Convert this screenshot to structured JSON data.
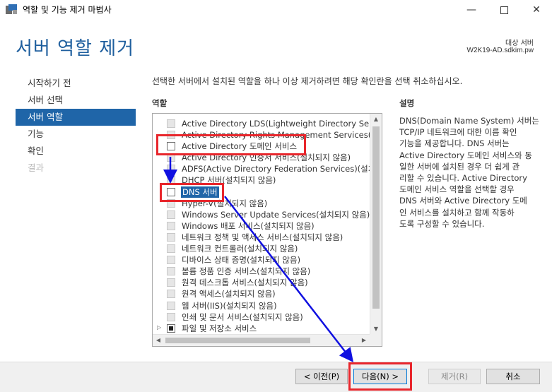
{
  "window": {
    "title": "역할 및 기능 제거 마법사",
    "minimize_glyph": "—",
    "close_glyph": "✕"
  },
  "header": {
    "title": "서버 역할 제거",
    "target_label": "대상 서버",
    "target_server": "W2K19-AD.sdkim.pw"
  },
  "nav": {
    "items": [
      {
        "label": "시작하기 전",
        "state": "normal"
      },
      {
        "label": "서버 선택",
        "state": "normal"
      },
      {
        "label": "서버 역할",
        "state": "active"
      },
      {
        "label": "기능",
        "state": "normal"
      },
      {
        "label": "확인",
        "state": "normal"
      },
      {
        "label": "결과",
        "state": "disabled"
      }
    ]
  },
  "main": {
    "instruction": "선택한 서버에서 설치된 역할을 하나 이상 제거하려면 해당 확인란을 선택 취소하십시오.",
    "roles_label": "역할",
    "description_label": "설명",
    "description_lines": [
      "DNS(Domain Name System) 서버는",
      "TCP/IP 네트워크에 대한 이름 확인",
      "기능을 제공합니다. DNS 서버는",
      "Active Directory 도메인 서비스와 동",
      "일한 서버에 설치된 경우 더 쉽게 관",
      "리할 수 있습니다. Active Directory",
      "도메인 서비스 역할을 선택할 경우",
      "DNS 서버와 Active Directory 도메",
      "인 서비스를 설치하고 함께 작동하",
      "도록 구성할 수 있습니다."
    ],
    "roles": [
      {
        "label": "Active Directory LDS(Lightweight Directory Servic",
        "state": "disabled"
      },
      {
        "label": "Active Directory Rights Management Services(설",
        "state": "disabled"
      },
      {
        "label": "Active Directory 도메인 서비스",
        "state": "enabled"
      },
      {
        "label": "Active Directory 인증서 서비스(설치되지 않음)",
        "state": "disabled"
      },
      {
        "label": "ADFS(Active Directory Federation Services)(설치되",
        "state": "disabled"
      },
      {
        "label": "DHCP 서버(설치되지 않음)",
        "state": "disabled"
      },
      {
        "label": "DNS 서버",
        "state": "enabled",
        "highlighted": true
      },
      {
        "label": "Hyper-V(설치되지 않음)",
        "state": "disabled"
      },
      {
        "label": "Windows Server Update Services(설치되지 않음)",
        "state": "disabled"
      },
      {
        "label": "Windows 배포 서비스(설치되지 않음)",
        "state": "disabled"
      },
      {
        "label": "네트워크 정책 및 액세스 서비스(설치되지 않음)",
        "state": "disabled"
      },
      {
        "label": "네트워크 컨트롤러(설치되지 않음)",
        "state": "disabled"
      },
      {
        "label": "디바이스 상태 증명(설치되지 않음)",
        "state": "disabled"
      },
      {
        "label": "볼륨 정품 인증 서비스(설치되지 않음)",
        "state": "disabled"
      },
      {
        "label": "원격 데스크톱 서비스(설치되지 않음)",
        "state": "disabled"
      },
      {
        "label": "원격 액세스(설치되지 않음)",
        "state": "disabled"
      },
      {
        "label": "웹 서버(IIS)(설치되지 않음)",
        "state": "disabled"
      },
      {
        "label": "인쇄 및 문서 서비스(설치되지 않음)",
        "state": "disabled"
      },
      {
        "label": "파일 및 저장소 서비스",
        "state": "partial",
        "expandable": true
      }
    ]
  },
  "footer": {
    "prev_label": "< 이전(P)",
    "next_label": "다음(N) >",
    "remove_label": "제거(R)",
    "cancel_label": "취소"
  },
  "colors": {
    "accent": "#1f65a8",
    "title_blue": "#1f5f9e",
    "annotation_red": "#e8262c",
    "annotation_arrow": "#1010e0"
  }
}
